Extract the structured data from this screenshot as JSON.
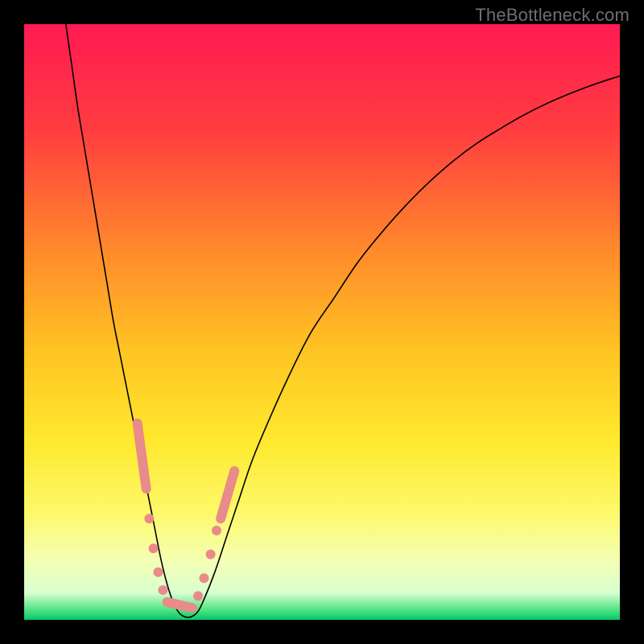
{
  "watermark": "TheBottleneck.com",
  "chart_data": {
    "type": "line",
    "title": "",
    "xlabel": "",
    "ylabel": "",
    "xlim": [
      0,
      100
    ],
    "ylim": [
      0,
      100
    ],
    "background_gradient": {
      "stops": [
        {
          "offset": 0.0,
          "color": "#ff1a53"
        },
        {
          "offset": 0.18,
          "color": "#ff3d3f"
        },
        {
          "offset": 0.38,
          "color": "#ff8a2b"
        },
        {
          "offset": 0.55,
          "color": "#ffc423"
        },
        {
          "offset": 0.7,
          "color": "#ffe92e"
        },
        {
          "offset": 0.82,
          "color": "#fdf96a"
        },
        {
          "offset": 0.9,
          "color": "#f5ffb3"
        },
        {
          "offset": 0.955,
          "color": "#d8ffd0"
        },
        {
          "offset": 0.985,
          "color": "#47e17e"
        },
        {
          "offset": 1.0,
          "color": "#06c66a"
        }
      ]
    },
    "series": [
      {
        "name": "bottleneck-curve",
        "color": "#000000",
        "width": 1.6,
        "x": [
          7,
          8,
          9,
          10,
          11,
          12,
          13,
          14,
          15,
          16,
          17,
          18,
          19,
          20,
          21,
          22,
          23,
          24,
          25,
          26,
          27,
          28,
          29,
          30,
          32,
          34,
          36,
          38,
          40,
          44,
          48,
          52,
          56,
          60,
          64,
          68,
          72,
          76,
          80,
          84,
          88,
          92,
          96,
          100
        ],
        "y": [
          100,
          93,
          86,
          80,
          74,
          68,
          62,
          56,
          50,
          45,
          40,
          35,
          30,
          25,
          20,
          15,
          10,
          6,
          3,
          1.2,
          0.5,
          0.5,
          1.2,
          3,
          8,
          14,
          20,
          26,
          31,
          40,
          48,
          54,
          60,
          65,
          69.5,
          73.5,
          77,
          80,
          82.5,
          84.8,
          86.8,
          88.5,
          90,
          91.3
        ]
      }
    ],
    "markers": {
      "name": "highlight-dots",
      "color": "#e98b89",
      "radius_small": 6,
      "radius_pill_half": 6,
      "points": [
        {
          "x": 20.2,
          "y": 24
        },
        {
          "x": 21.0,
          "y": 17
        },
        {
          "x": 21.7,
          "y": 12
        },
        {
          "x": 22.5,
          "y": 8
        },
        {
          "x": 23.3,
          "y": 5
        },
        {
          "x": 29.2,
          "y": 4
        },
        {
          "x": 30.2,
          "y": 7
        },
        {
          "x": 31.3,
          "y": 11
        },
        {
          "x": 32.3,
          "y": 15
        }
      ],
      "pills": [
        {
          "x1": 19.0,
          "y1": 33,
          "x2": 20.5,
          "y2": 22
        },
        {
          "x1": 24.0,
          "y1": 3.0,
          "x2": 28.2,
          "y2": 2.0
        },
        {
          "x1": 33.0,
          "y1": 17,
          "x2": 35.3,
          "y2": 25
        }
      ]
    }
  }
}
